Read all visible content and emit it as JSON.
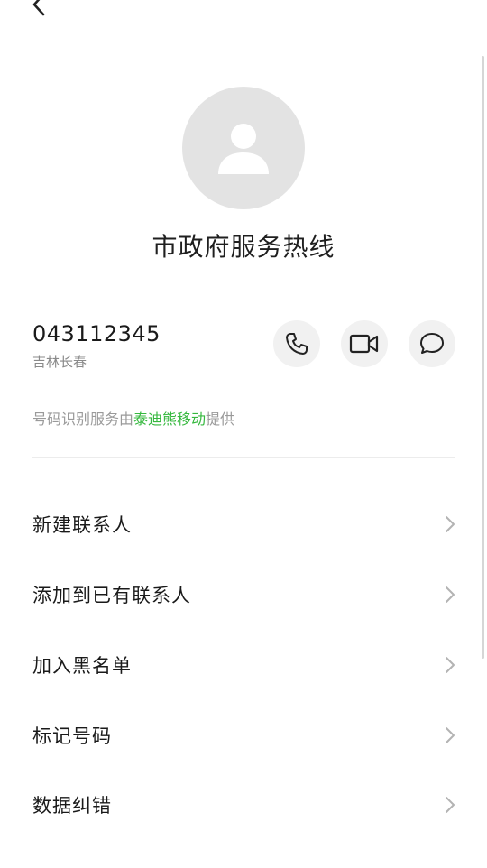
{
  "contact": {
    "name": "市政府服务热线",
    "number": "043112345",
    "location": "吉林长春"
  },
  "provider": {
    "prefix": "号码识别服务由",
    "brand": "泰迪熊移动",
    "suffix": "提供",
    "brand_color": "#35b83e"
  },
  "actions": {
    "call_icon": "phone-icon",
    "video_icon": "video-camera-icon",
    "message_icon": "chat-bubble-icon"
  },
  "menu": [
    {
      "label": "新建联系人"
    },
    {
      "label": "添加到已有联系人"
    },
    {
      "label": "加入黑名单"
    },
    {
      "label": "标记号码"
    },
    {
      "label": "数据纠错"
    }
  ]
}
